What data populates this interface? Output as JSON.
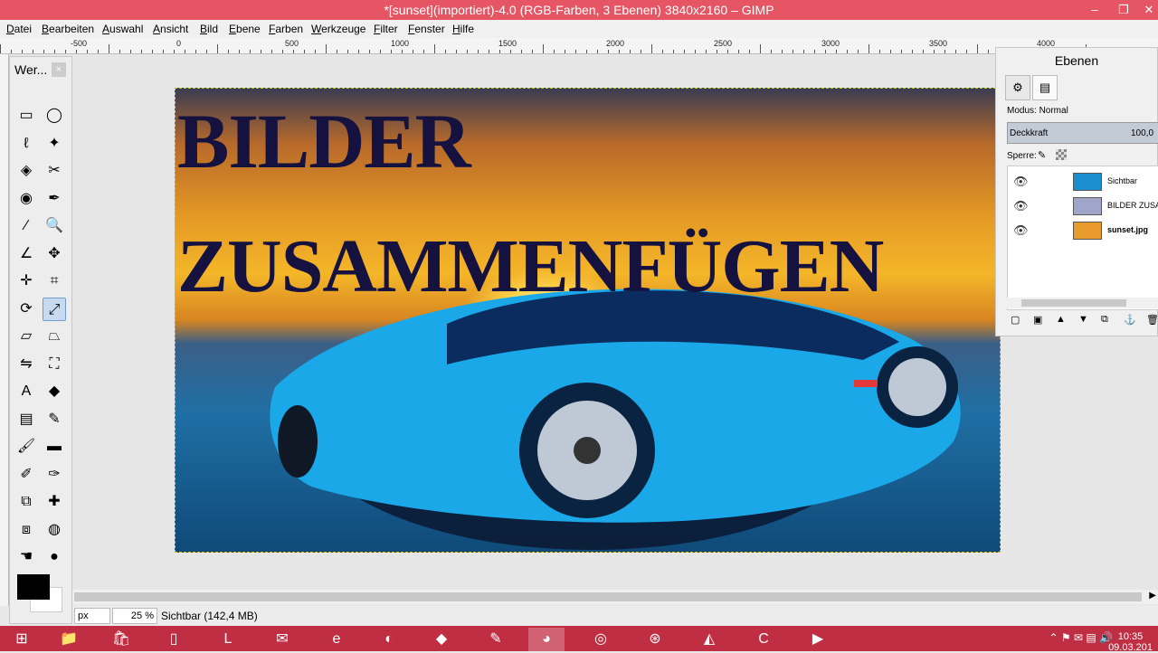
{
  "window": {
    "title": "*[sunset](importiert)-4.0 (RGB-Farben, 3 Ebenen) 3840x2160 – GIMP",
    "min_glyph": "–",
    "max_glyph": "❐",
    "close_glyph": "✕"
  },
  "menu": [
    "Datei",
    "Bearbeiten",
    "Auswahl",
    "Ansicht",
    "Bild",
    "Ebene",
    "Farben",
    "Werkzeuge",
    "Filter",
    "Fenster",
    "Hilfe"
  ],
  "ruler": {
    "labels": [
      "-500",
      "0",
      "500",
      "1000",
      "1500",
      "2000",
      "2500",
      "3000",
      "3500",
      "4000"
    ]
  },
  "canvas": {
    "headline_line1": "BILDER",
    "headline_line2": "ZUSAMMENFÜGEN"
  },
  "toolbox": {
    "title": "Wer...",
    "close": "×",
    "icons": [
      "rect-select-icon",
      "ellipse-select-icon",
      "free-select-icon",
      "fuzzy-select-icon",
      "color-select-icon",
      "scissors-icon",
      "foreground-select-icon",
      "paths-icon",
      "color-picker-icon",
      "zoom-icon",
      "measure-icon",
      "move-icon",
      "align-icon",
      "crop-icon",
      "rotate-icon",
      "scale-icon",
      "shear-icon",
      "perspective-icon",
      "flip-icon",
      "cage-icon",
      "text-icon",
      "bucket-fill-icon",
      "blend-icon",
      "pencil-icon",
      "paintbrush-icon",
      "eraser-icon",
      "airbrush-icon",
      "ink-icon",
      "clone-icon",
      "heal-icon",
      "perspective-clone-icon",
      "blur-icon",
      "smudge-icon",
      "dodge-burn-icon"
    ],
    "glyphs": [
      "▭",
      "◯",
      "ℓ",
      "✦",
      "◈",
      "✂",
      "◉",
      "✒",
      "⁄",
      "🔍",
      "∠",
      "✥",
      "✛",
      "⌗",
      "⟳",
      "⤢",
      "▱",
      "⏢",
      "⇋",
      "⛶",
      "A",
      "◆",
      "▤",
      "✎",
      "🖌",
      "▬",
      "✐",
      "✑",
      "⧉",
      "✚",
      "⧈",
      "◍",
      "☚",
      "●"
    ]
  },
  "status": {
    "unit": "px",
    "zoom": "25 %",
    "text": "Sichtbar (142,4 MB)"
  },
  "layers_dock": {
    "title": "Ebenen",
    "mode_label": "Modus: Normal",
    "opacity_label": "Deckkraft",
    "opacity_value": "100,0",
    "lock_label": "Sperre:",
    "layers": [
      {
        "name": "Sichtbar",
        "bold": false,
        "thumb": "#1b8fd0"
      },
      {
        "name": "BILDER ZUSAMMENFÜGEN",
        "bold": false,
        "thumb": "#9fa6c9"
      },
      {
        "name": "sunset.jpg",
        "bold": true,
        "thumb": "#e89a2a"
      }
    ],
    "bottom_buttons": [
      "new-layer-icon",
      "new-group-icon",
      "raise-layer-icon",
      "lower-layer-icon",
      "duplicate-layer-icon",
      "anchor-layer-icon",
      "delete-layer-icon"
    ],
    "bottom_glyphs": [
      "▢",
      "▣",
      "▲",
      "▼",
      "⧉",
      "⚓",
      "🗑"
    ]
  },
  "taskbar": {
    "apps": [
      "windows-start-icon",
      "file-explorer-icon",
      "store-icon",
      "document-icon",
      "lenovo-icon",
      "mail-icon",
      "internet-explorer-icon",
      "media-icon",
      "game-icon",
      "paint-icon",
      "gimp-icon",
      "firefox-icon",
      "blender-icon",
      "inkscape-icon",
      "camtasia-icon",
      "recorder-icon"
    ],
    "glyphs": [
      "⊞",
      "📁",
      "🛍",
      "▯",
      "L",
      "✉",
      "e",
      "◐",
      "◆",
      "✎",
      "◕",
      "◎",
      "⊛",
      "◭",
      "C",
      "▶"
    ],
    "tray": "⌃ ⚑ ✉ ▤ 🔊",
    "clock_time": "10:35",
    "clock_date": "09.03.201"
  }
}
